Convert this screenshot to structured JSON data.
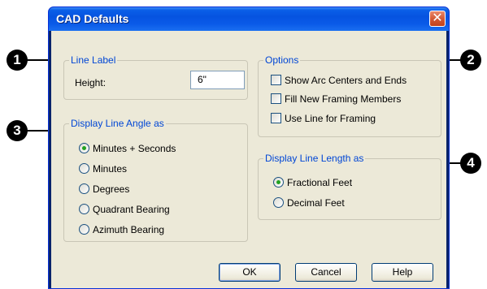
{
  "window": {
    "title": "CAD Defaults",
    "close_symbol": "✕"
  },
  "line_label": {
    "legend": "Line Label",
    "height_label": "Height:",
    "height_value": "6\""
  },
  "options": {
    "legend": "Options",
    "items": [
      {
        "label": "Show Arc Centers and Ends",
        "checked": false
      },
      {
        "label": "Fill New Framing Members",
        "checked": false
      },
      {
        "label": "Use Line for Framing",
        "checked": false
      }
    ]
  },
  "angle": {
    "legend": "Display Line Angle as",
    "items": [
      {
        "label": "Minutes + Seconds",
        "selected": true
      },
      {
        "label": "Minutes",
        "selected": false
      },
      {
        "label": "Degrees",
        "selected": false
      },
      {
        "label": "Quadrant Bearing",
        "selected": false
      },
      {
        "label": "Azimuth Bearing",
        "selected": false
      }
    ]
  },
  "length": {
    "legend": "Display Line Length as",
    "items": [
      {
        "label": "Fractional Feet",
        "selected": true
      },
      {
        "label": "Decimal Feet",
        "selected": false
      }
    ]
  },
  "buttons": {
    "ok": "OK",
    "cancel": "Cancel",
    "help": "Help"
  },
  "callouts": [
    "1",
    "2",
    "3",
    "4"
  ]
}
